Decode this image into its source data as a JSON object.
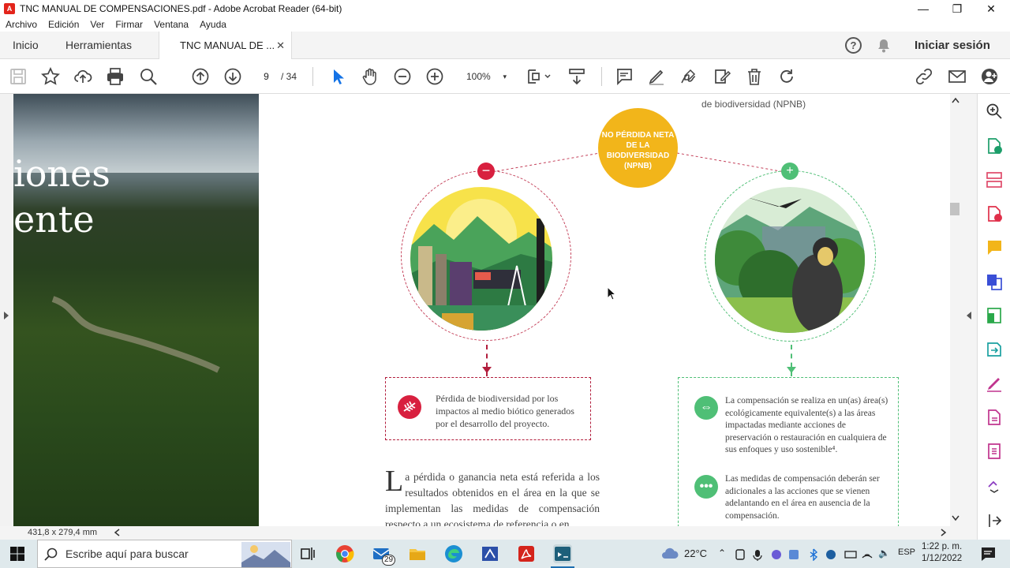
{
  "window": {
    "title": "TNC MANUAL DE COMPENSACIONES.pdf - Adobe Acrobat Reader (64-bit)",
    "app_icon": "pdf-icon",
    "controls": {
      "minimize": "—",
      "maximize": "❐",
      "close": "✕"
    }
  },
  "menu": [
    "Archivo",
    "Edición",
    "Ver",
    "Firmar",
    "Ventana",
    "Ayuda"
  ],
  "tabs": {
    "home": "Inicio",
    "tools": "Herramientas",
    "document": "TNC MANUAL DE ...",
    "close": "✕",
    "signin": "Iniciar sesión",
    "help": "?"
  },
  "toolbar": {
    "page_current": "9",
    "page_total": "/ 34",
    "zoom": "100%",
    "zoom_dd": "▾"
  },
  "document": {
    "photo_text_1": "iones",
    "photo_text_2": "ente",
    "npnb_top": "de biodiversidad (NPNB)",
    "npnb_circle": "NO PÉRDIDA NETA DE LA BIODIVERSIDAD (NPNB)",
    "minus": "−",
    "plus": "+",
    "loss_text": "Pérdida de biodiversidad por los impactos al medio biótico generados por el desarrollo del proyecto.",
    "gain_text_1": "La compensación se realiza en un(as) área(s) ecológicamente equivalente(s) a las áreas impactadas mediante acciones de preservación o restauración en cualquiera de sus enfoques y uso sostenible⁴.",
    "gain_text_2": "Las medidas de compensación deberán ser adicionales a las acciones que se vienen adelantando en el área en ausencia de la compensación.",
    "para_cap": "L",
    "para_text": "a pérdida o ganancia neta está referida a los resultados obtenidos en el área en la que se implementan las medidas de compensación respecto a un ecosistema de referencia o en"
  },
  "status": {
    "dimensions": "431,8 x 279,4 mm"
  },
  "taskbar": {
    "search_placeholder": "Escribe aquí para buscar",
    "mail_badge": "29",
    "weather": "22°C",
    "lang": "ESP",
    "time": "1:22 p. m.",
    "date": "1/12/2022"
  },
  "colors": {
    "accent_red": "#d8203f",
    "accent_green": "#4fbf76",
    "npnb_yellow": "#f2b51a"
  }
}
